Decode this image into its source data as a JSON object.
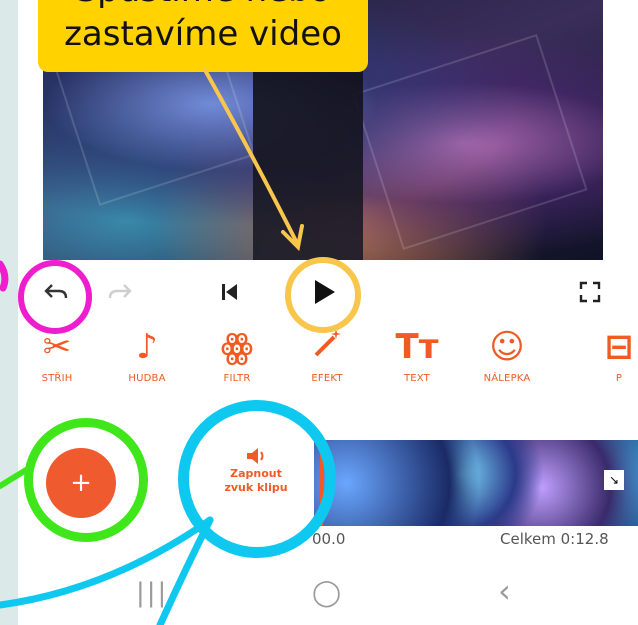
{
  "callout": {
    "line1": "Spustíme nebo",
    "line2": "zastavíme video"
  },
  "toolbar": {
    "items": [
      {
        "label": "STŘIH",
        "icon": "scissors-icon",
        "glyph": "✂"
      },
      {
        "label": "HUDBA",
        "icon": "music-note-icon",
        "glyph": "♪"
      },
      {
        "label": "FILTR",
        "icon": "filter-circles-icon",
        "glyph": "ꙮ"
      },
      {
        "label": "EFEKT",
        "icon": "magic-wand-icon",
        "glyph": "⁄"
      },
      {
        "label": "TEXT",
        "icon": "text-icon",
        "glyph": "Tт"
      },
      {
        "label": "NÁLEPKA",
        "icon": "sticker-smiley-icon",
        "glyph": "☺"
      },
      {
        "label": "P",
        "icon": "partial-tool-icon",
        "glyph": "⊟"
      }
    ]
  },
  "controls": {
    "undo_icon": "undo-icon",
    "redo_icon": "redo-icon",
    "prev_icon": "skip-previous-icon",
    "play_icon": "play-icon",
    "fullscreen_icon": "fullscreen-icon"
  },
  "add_button": {
    "label": "+"
  },
  "sound_button": {
    "line1": "Zapnout",
    "line2": "zvuk klipu"
  },
  "timeline": {
    "start": "00.0",
    "total": "Celkem 0:12.8"
  },
  "navbar": {
    "recents": "|||",
    "home": "◯",
    "back": "‹"
  },
  "colors": {
    "accent": "#f15a22",
    "callout": "#ffd200",
    "ring_magenta": "#ee1ecf",
    "ring_yellow": "#f9c64c",
    "ring_green": "#3fe71a",
    "ring_cyan": "#0ec8ef",
    "background": "#dbe9e9"
  }
}
